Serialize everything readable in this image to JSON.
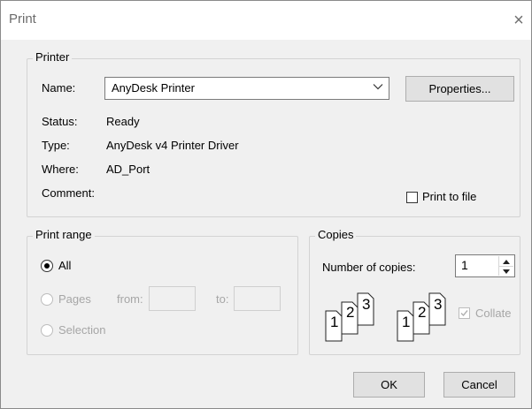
{
  "dialog": {
    "title": "Print",
    "close_glyph": "×"
  },
  "printer": {
    "legend": "Printer",
    "name_label": "Name:",
    "name_value": "AnyDesk Printer",
    "properties_button": "Properties...",
    "status_label": "Status:",
    "status_value": "Ready",
    "type_label": "Type:",
    "type_value": "AnyDesk v4 Printer Driver",
    "where_label": "Where:",
    "where_value": "AD_Port",
    "comment_label": "Comment:",
    "comment_value": "",
    "print_to_file_label": "Print to file",
    "print_to_file_checked": false
  },
  "print_range": {
    "legend": "Print range",
    "all_label": "All",
    "pages_label": "Pages",
    "from_label": "from:",
    "to_label": "to:",
    "from_value": "",
    "to_value": "",
    "selection_label": "Selection",
    "selected": "All"
  },
  "copies": {
    "legend": "Copies",
    "number_label": "Number of copies:",
    "number_value": "1",
    "collate_label": "Collate",
    "collate_checked": true,
    "page_icon_numbers": [
      "1",
      "2",
      "3"
    ]
  },
  "footer": {
    "ok_button": "OK",
    "cancel_button": "Cancel"
  },
  "icons": [
    "close-icon",
    "chevron-down-icon",
    "spin-up-icon",
    "spin-down-icon",
    "collate-pages-icon",
    "check-icon"
  ]
}
